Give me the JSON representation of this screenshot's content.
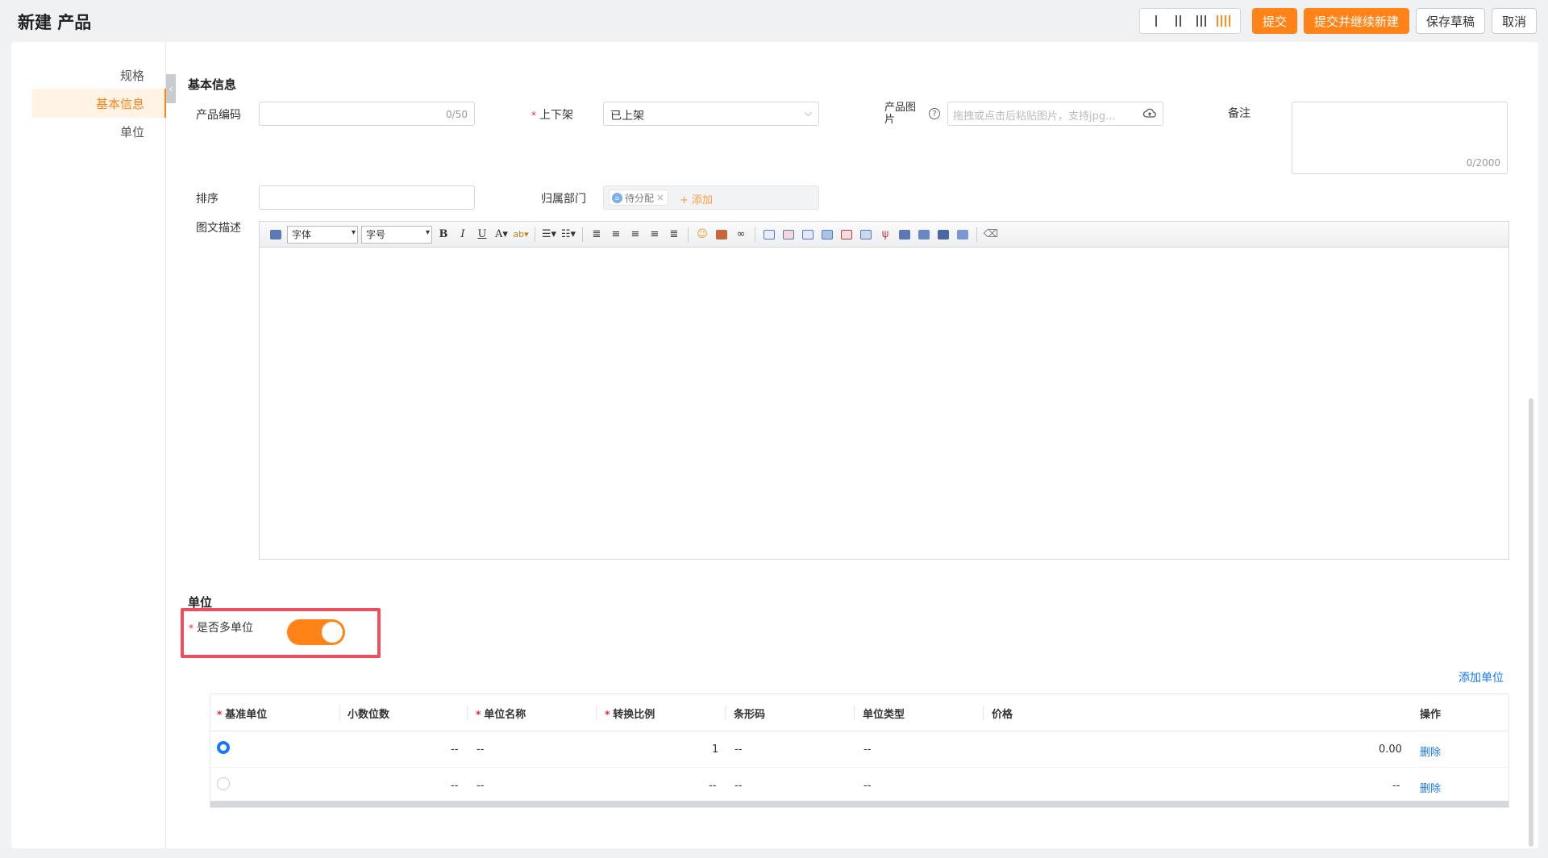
{
  "header": {
    "title": "新建 产品",
    "layout_options": [
      "1",
      "2",
      "3",
      "4"
    ],
    "active_layout": 4,
    "buttons": {
      "submit": "提交",
      "submit_continue": "提交并继续新建",
      "save_draft": "保存草稿",
      "cancel": "取消"
    }
  },
  "sidebar": {
    "items": [
      {
        "label": "规格"
      },
      {
        "label": "基本信息"
      },
      {
        "label": "单位"
      }
    ],
    "active": "基本信息"
  },
  "basic": {
    "section_title": "基本信息",
    "code_label": "产品编码",
    "code_counter": "0/50",
    "shelf_label": "上下架",
    "shelf_value": "已上架",
    "image_label": "产品图片",
    "image_placeholder": "拖拽或点击后粘贴图片，支持jpg...",
    "remark_label": "备注",
    "remark_counter": "0/2000",
    "sort_label": "排序",
    "dept_label": "归属部门",
    "dept_tag": "待分配",
    "dept_add": "+ 添加",
    "desc_label": "图文描述",
    "font_select": "字体",
    "size_select": "字号"
  },
  "unit": {
    "section_title": "单位",
    "multi_label": "是否多单位",
    "multi_enabled": true,
    "add_unit": "添加单位",
    "columns": [
      "基准单位",
      "小数位数",
      "单位名称",
      "转换比例",
      "条形码",
      "单位类型",
      "价格",
      "操作"
    ],
    "rows": [
      {
        "base": true,
        "decimals": "--",
        "name": "--",
        "ratio": "1",
        "barcode": "--",
        "type": "--",
        "price": "0.00",
        "action": "删除"
      },
      {
        "base": false,
        "decimals": "--",
        "name": "--",
        "ratio": "--",
        "barcode": "--",
        "type": "--",
        "price": "--",
        "action": "删除"
      }
    ]
  },
  "colors": {
    "accent": "#ff8316",
    "link": "#1677ff",
    "highlight": "#ee4e5d"
  }
}
